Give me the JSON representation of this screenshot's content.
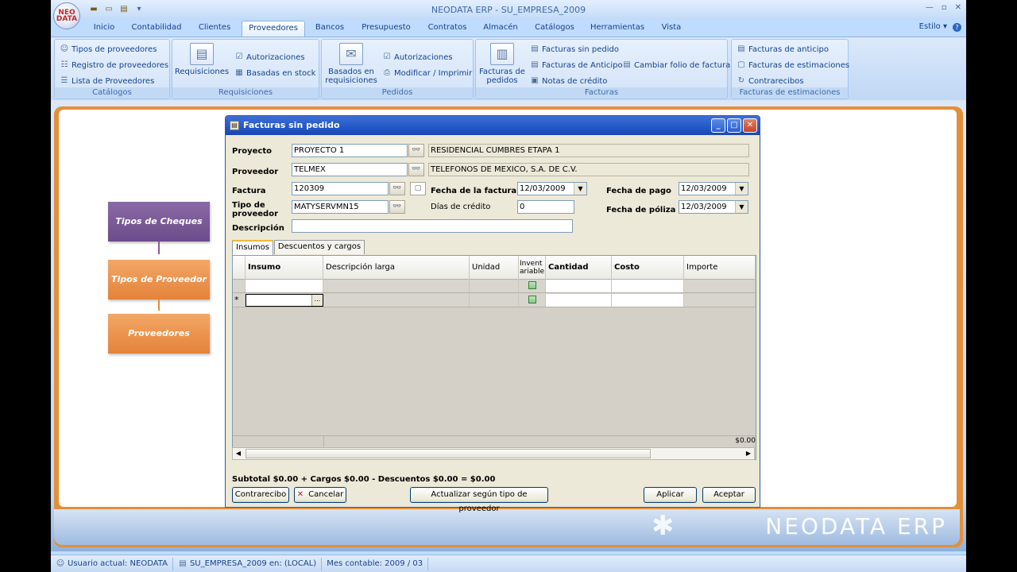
{
  "app": {
    "window_title": "NEODATA ERP - SU_EMPRESA_2009",
    "logo_text": "NEO DATA",
    "estilo_label": "Estilo",
    "brand_watermark": "NEODATA ERP"
  },
  "tabs": [
    "Inicio",
    "Contabilidad",
    "Clientes",
    "Proveedores",
    "Bancos",
    "Presupuesto",
    "Contratos",
    "Almacén",
    "Catálogos",
    "Herramientas",
    "Vista"
  ],
  "active_tab": "Proveedores",
  "ribbon": {
    "catalogos": {
      "label": "Catálogos",
      "items": [
        "Tipos de proveedores",
        "Registro de proveedores",
        "Lista de Proveedores"
      ]
    },
    "requisiciones": {
      "label": "Requisiciones",
      "big": "Requisiciones",
      "items": [
        "Autorizaciones",
        "Basadas en stock"
      ]
    },
    "pedidos": {
      "label": "Pedidos",
      "big": "Basados en requisiciones",
      "items": [
        "Autorizaciones",
        "Modificar / Imprimir"
      ]
    },
    "facturas": {
      "label": "Facturas",
      "big": "Facturas de pedidos",
      "items": [
        "Facturas sin pedido",
        "Facturas de Anticipo",
        "Notas de crédito",
        "Cambiar folio de factura"
      ]
    },
    "estimaciones": {
      "label": "Facturas de estimaciones",
      "items": [
        "Facturas de anticipo",
        "Facturas de estimaciones",
        "Contrarecibos"
      ]
    }
  },
  "flow": [
    "Tipos de Cheques",
    "Tipos de Proveedor",
    "Proveedores"
  ],
  "dialog": {
    "title": "Facturas sin pedido",
    "labels": {
      "proyecto": "Proyecto",
      "proveedor": "Proveedor",
      "factura": "Factura",
      "tipo_proveedor": "Tipo de proveedor",
      "descripcion": "Descripción",
      "fecha_factura": "Fecha de la factura",
      "dias_credito": "Días de crédito",
      "fecha_pago": "Fecha de pago",
      "fecha_poliza": "Fecha de póliza"
    },
    "values": {
      "proyecto_code": "PROYECTO 1",
      "proyecto_name": "RESIDENCIAL CUMBRES ETAPA 1",
      "proveedor_code": "TELMEX",
      "proveedor_name": "TELEFONOS DE MEXICO, S.A. DE C.V.",
      "factura": "120309",
      "tipo_proveedor": "MATYSERVMN15",
      "descripcion": "",
      "fecha_factura": "12/03/2009",
      "dias_credito": "0",
      "fecha_pago": "12/03/2009",
      "fecha_poliza": "12/03/2009"
    },
    "subtabs": [
      "Insumos",
      "Descuentos y cargos"
    ],
    "grid_columns": [
      "Insumo",
      "Descripción larga",
      "Unidad",
      "Invent ariable",
      "Cantidad",
      "Costo",
      "Importe"
    ],
    "new_row_marker": "*",
    "ellipsis": "...",
    "total_value": "$0.00",
    "summary": "Subtotal $0.00 + Cargos $0.00 - Descuentos $0.00 = $0.00",
    "buttons": {
      "contrarecibo": "Contrarecibo",
      "cancelar": "Cancelar",
      "actualizar": "Actualizar según tipo de proveedor",
      "aplicar": "Aplicar",
      "aceptar": "Aceptar"
    }
  },
  "status": {
    "usuario": "Usuario actual: NEODATA",
    "empresa": "SU_EMPRESA_2009 en: (LOCAL)",
    "mes": "Mes contable: 2009 / 03"
  }
}
